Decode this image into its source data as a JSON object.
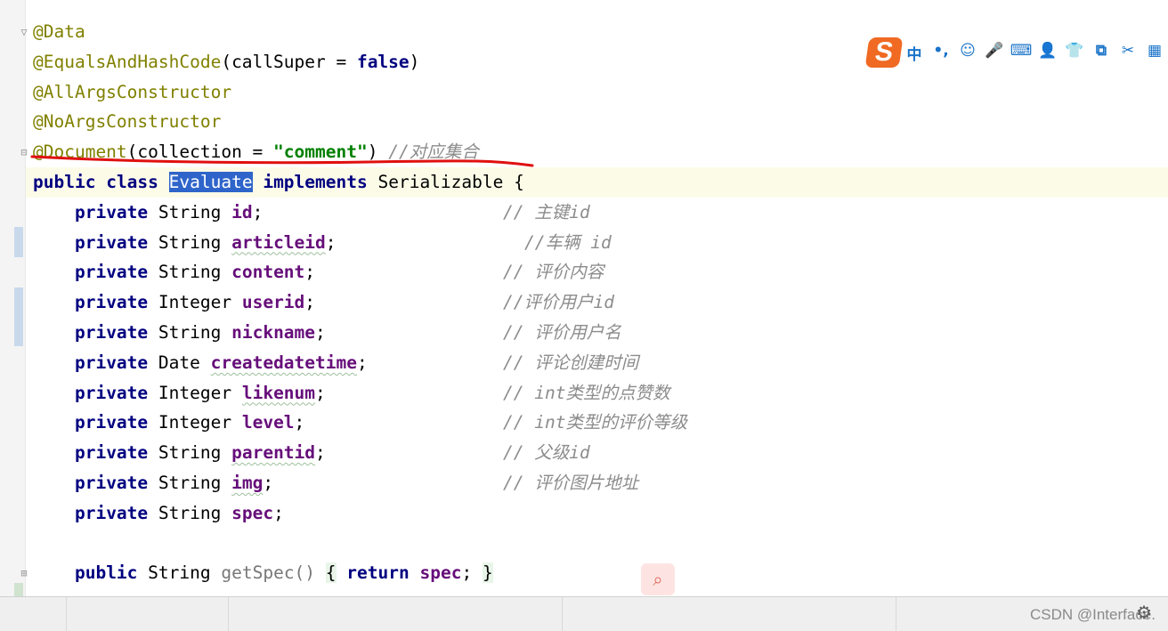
{
  "code": {
    "ann_data": "@Data",
    "ann_equals": "@EqualsAndHashCode",
    "ann_equals_args_open": "(callSuper = ",
    "ann_equals_false": "false",
    "ann_equals_args_close": ")",
    "ann_allargs": "@AllArgsConstructor",
    "ann_noargs": "@NoArgsConstructor",
    "ann_document": "@Document",
    "ann_document_args_open": "(collection = ",
    "ann_document_value": "\"comment\"",
    "ann_document_args_close": ")",
    "ann_document_comment": "//对应集合",
    "class_public": "public",
    "class_class": "class",
    "class_name": "Evaluate",
    "class_implements": "implements",
    "class_iface": "Serializable",
    "class_brace": "{",
    "private_kw": "private",
    "fields": [
      {
        "type": "String",
        "name": "id",
        "comment": "// 主键id"
      },
      {
        "type": "String",
        "name": "articleid",
        "comment": "//车辆 id"
      },
      {
        "type": "String",
        "name": "content",
        "comment": "// 评价内容"
      },
      {
        "type": "Integer",
        "name": "userid",
        "comment": "//评价用户id"
      },
      {
        "type": "String",
        "name": "nickname",
        "comment": "// 评价用户名"
      },
      {
        "type": "Date",
        "name": "createdatetime",
        "comment": "// 评论创建时间"
      },
      {
        "type": "Integer",
        "name": "likenum",
        "comment": "// int类型的点赞数"
      },
      {
        "type": "Integer",
        "name": "level",
        "comment": "// int类型的评价等级"
      },
      {
        "type": "String",
        "name": "parentid",
        "comment": "// 父级id"
      },
      {
        "type": "String",
        "name": "img",
        "comment": "// 评价图片地址"
      },
      {
        "type": "String",
        "name": "spec",
        "comment": ""
      }
    ],
    "getter_public": "public",
    "getter_type": "String",
    "getter_name": "getSpec()",
    "getter_open": "{",
    "getter_return": "return",
    "getter_field": "spec",
    "getter_semi": ";",
    "getter_close": "}"
  },
  "ime": {
    "logo": "S",
    "items": [
      "中",
      "•,",
      "☺",
      "🎤",
      "⌨",
      "👤",
      "👕",
      "⧉",
      "✂",
      "▦"
    ]
  },
  "watermark": "CSDN @Interface.",
  "colors": {
    "keyword": "#000080",
    "annotation": "#808000",
    "string": "#008000",
    "field": "#660e7a",
    "comment": "#8c8c8c",
    "selection": "#2f65ca",
    "underline_red": "#e01010"
  }
}
